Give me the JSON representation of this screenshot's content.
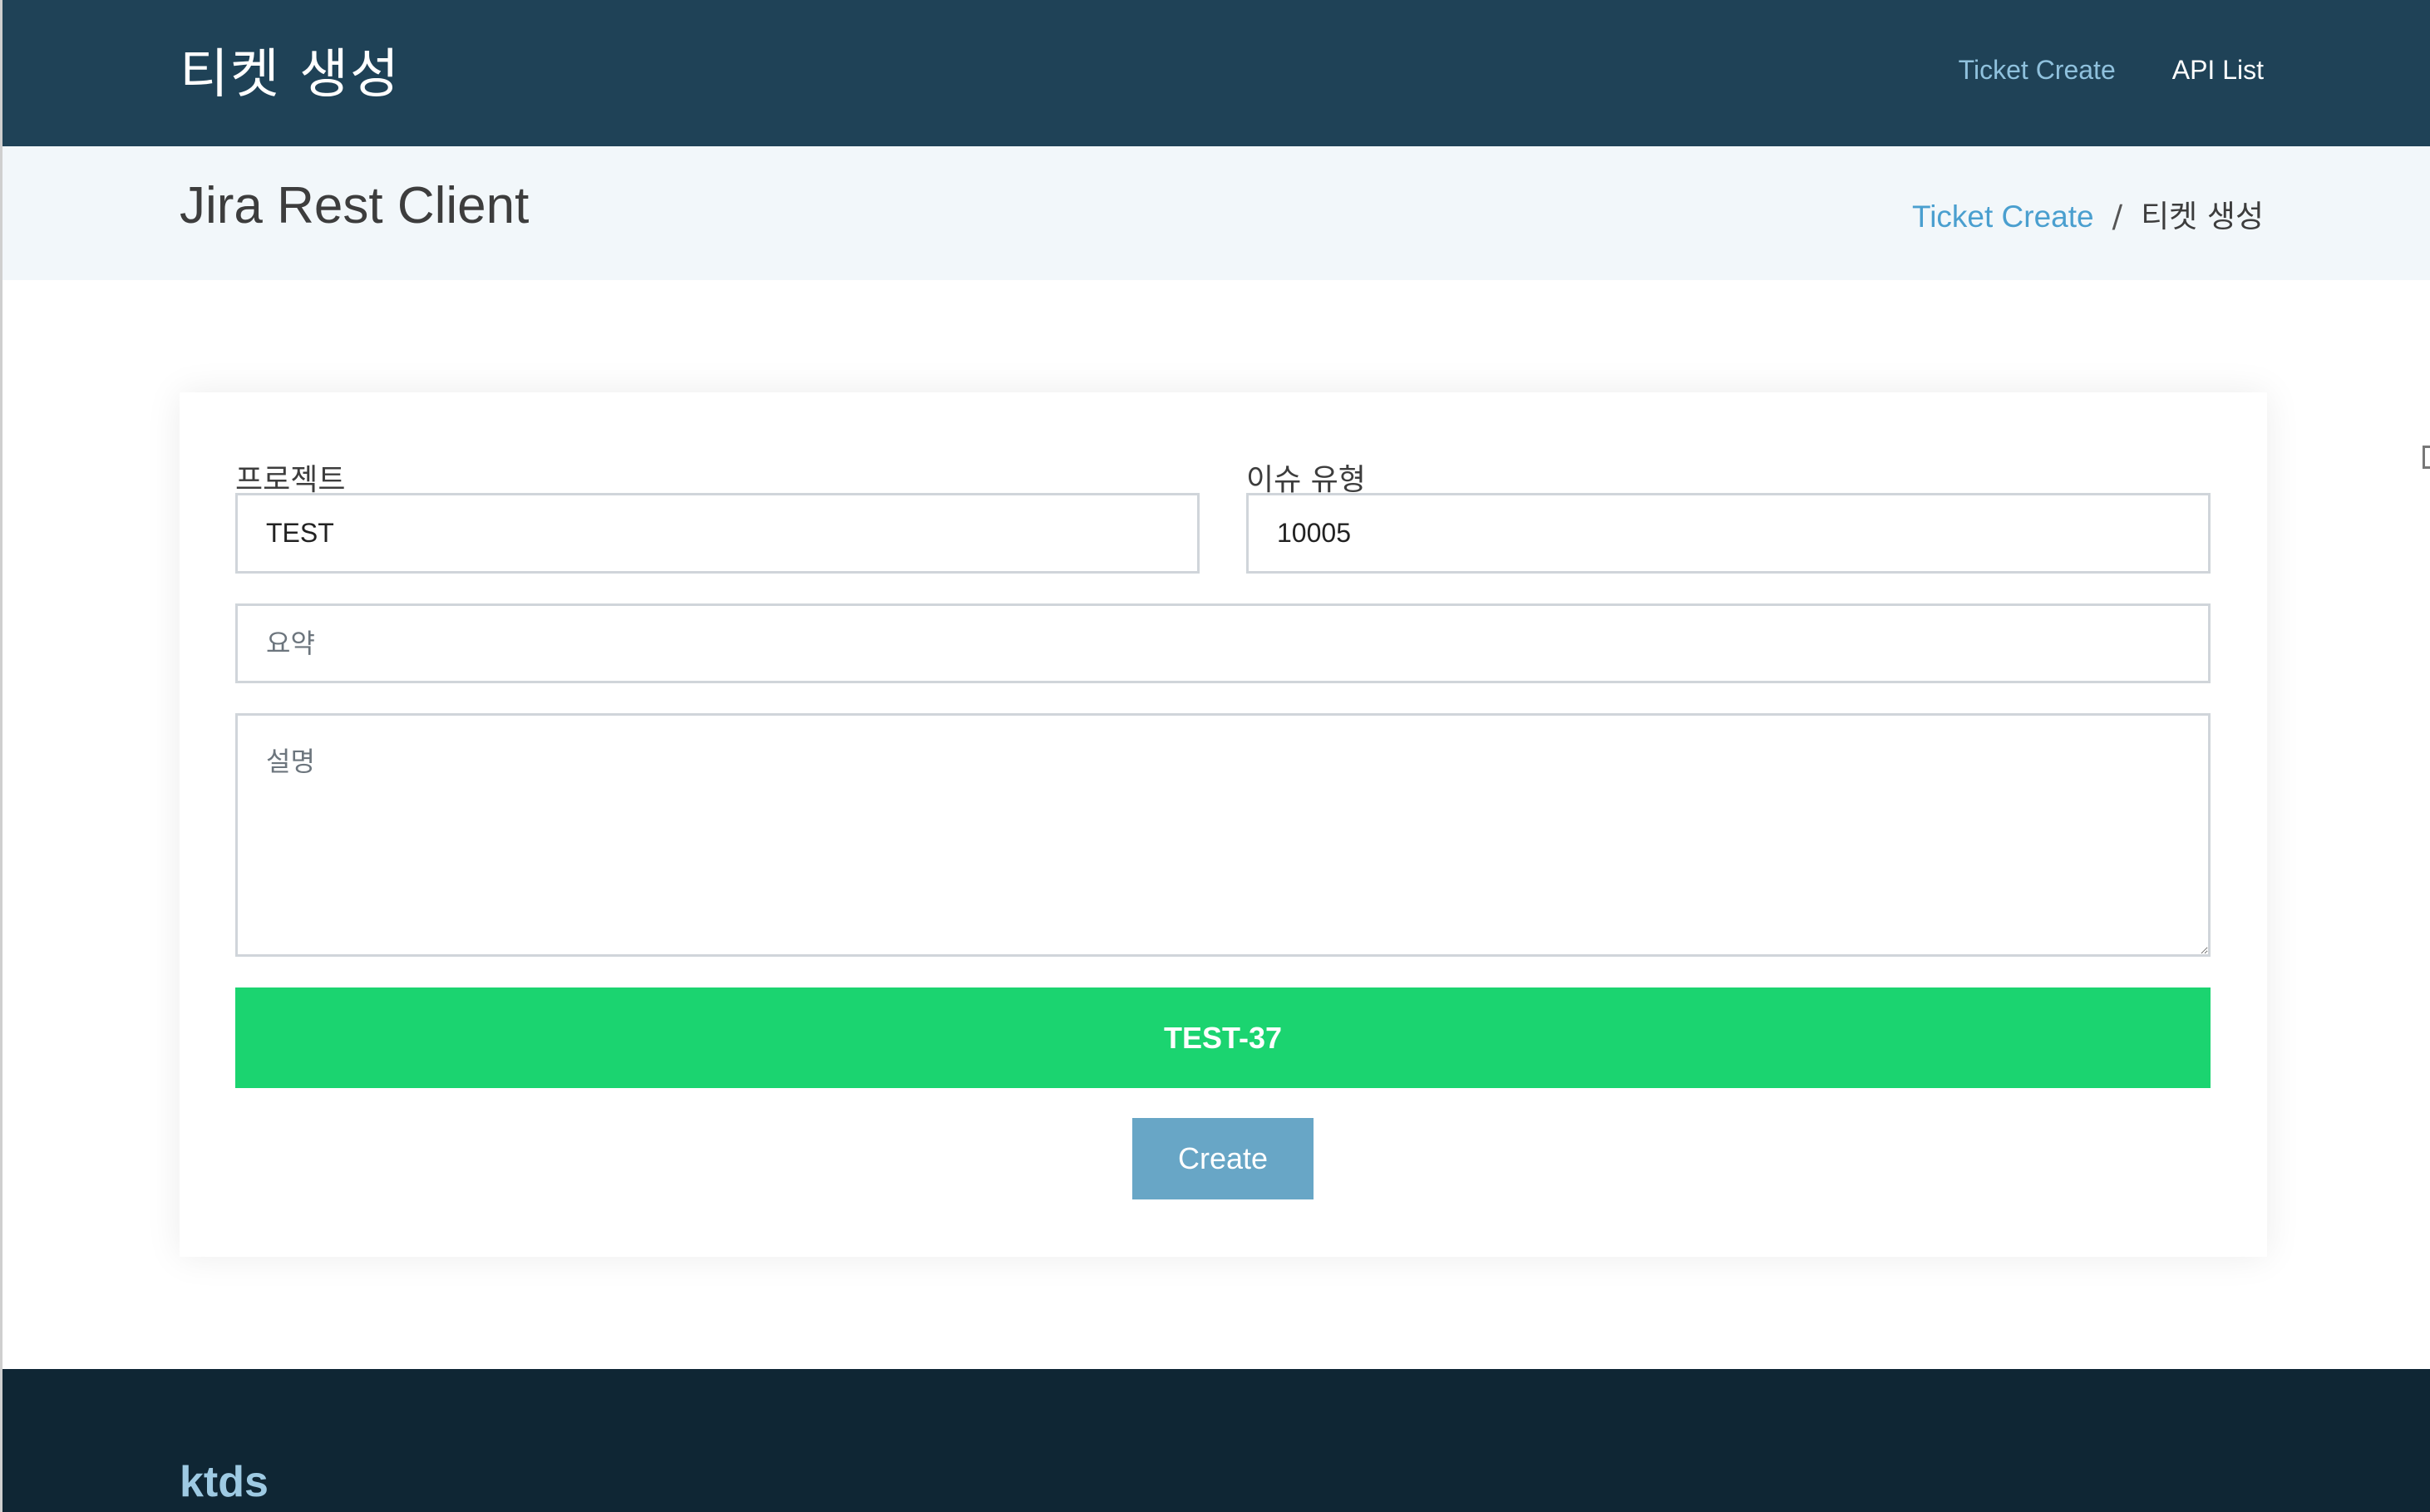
{
  "header": {
    "brand": "티켓 생성",
    "nav": [
      {
        "label": "Ticket Create",
        "active": true
      },
      {
        "label": "API List",
        "active": false
      }
    ]
  },
  "subheader": {
    "title": "Jira Rest Client",
    "breadcrumb": {
      "link": "Ticket Create",
      "separator": "/",
      "current": "티켓 생성"
    }
  },
  "form": {
    "project": {
      "label": "프로젝트",
      "value": "TEST"
    },
    "issue_type": {
      "label": "이슈 유형",
      "value": "10005"
    },
    "summary": {
      "placeholder": "요약",
      "value": ""
    },
    "description": {
      "placeholder": "설명",
      "value": ""
    },
    "result_text": "TEST-37",
    "create_label": "Create"
  },
  "footer": {
    "brand": "ktds"
  },
  "colors": {
    "header_bg": "#1f4257",
    "subheader_bg": "#f2f7fa",
    "result_bg": "#1bd470",
    "button_bg": "#68a6c6",
    "footer_bg": "#0f2634",
    "link": "#4a9fcf"
  }
}
